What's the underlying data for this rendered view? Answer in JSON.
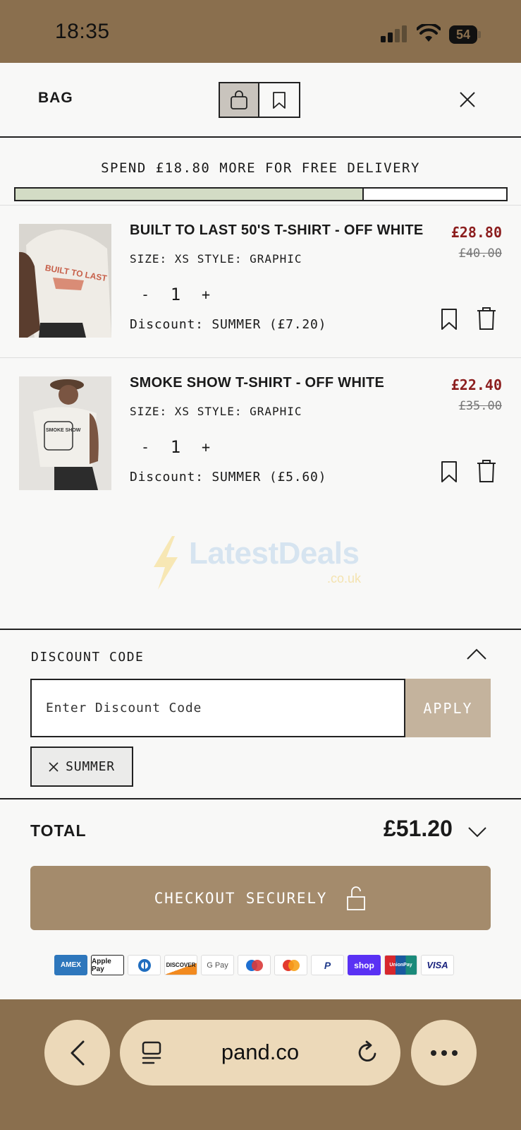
{
  "status_bar": {
    "time": "18:35",
    "battery": "54"
  },
  "header": {
    "title": "BAG",
    "close_icon": "close-icon"
  },
  "delivery": {
    "message": "SPEND £18.80 MORE FOR FREE DELIVERY",
    "progress": 0.71
  },
  "items": [
    {
      "name": "BUILT TO LAST 50'S T-SHIRT - OFF WHITE",
      "meta": "SIZE: XS  STYLE: GRAPHIC",
      "qty_minus": "-",
      "quantity": "1",
      "qty_plus": "+",
      "discount": "Discount: SUMMER (£7.20)",
      "price": "£28.80",
      "original_price": "£40.00",
      "print_text": "BUILT TO LAST"
    },
    {
      "name": "SMOKE SHOW T-SHIRT - OFF WHITE",
      "meta": "SIZE: XS  STYLE: GRAPHIC",
      "qty_minus": "-",
      "quantity": "1",
      "qty_plus": "+",
      "discount": "Discount: SUMMER (£5.60)",
      "price": "£22.40",
      "original_price": "£35.00",
      "print_text": "SMOKE SHOW"
    }
  ],
  "watermark": {
    "text": "LatestDeals",
    "sub": ".co.uk"
  },
  "discount_code": {
    "title": "DISCOUNT CODE",
    "placeholder": "Enter Discount Code",
    "apply_label": "APPLY",
    "applied_code": "SUMMER"
  },
  "total": {
    "label": "TOTAL",
    "value": "£51.20"
  },
  "checkout": {
    "label": "CHECKOUT SECURELY"
  },
  "payment_methods": [
    "AMEX",
    "Apple Pay",
    "Diners",
    "DISCOVER",
    "G Pay",
    "Maestro",
    "Mastercard",
    "PayPal",
    "shop",
    "UnionPay",
    "VISA"
  ],
  "browser": {
    "url": "pand.co"
  },
  "colors": {
    "accent": "#a48b6c",
    "price_red": "#8c1e1e",
    "progress_fill": "#d3dcc5",
    "browser_bg": "#8a6f4e"
  }
}
